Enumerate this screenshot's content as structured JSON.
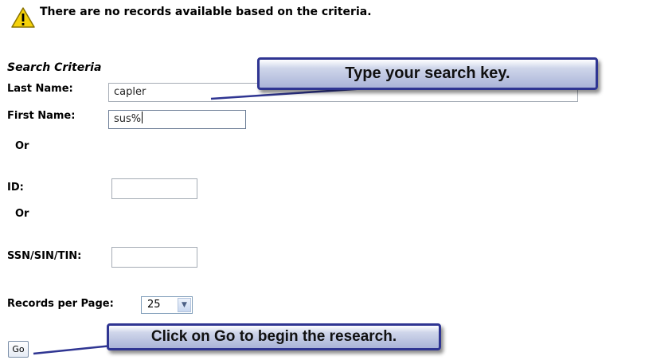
{
  "notice": {
    "icon": "warning-icon",
    "message": "There are no records available based on the criteria."
  },
  "search": {
    "title": "Search Criteria",
    "last_name": {
      "label": "Last Name:",
      "value": "capler"
    },
    "first_name": {
      "label": "First Name:",
      "value": "sus%"
    },
    "or_1": "Or",
    "id": {
      "label": "ID:",
      "value": ""
    },
    "or_2": "Or",
    "ssn": {
      "label": "SSN/SIN/TIN:",
      "value": ""
    },
    "records_per_page": {
      "label": "Records per Page:",
      "value": "25"
    },
    "go_label": "Go"
  },
  "callouts": {
    "search_key": "Type your search key.",
    "go_hint": "Click on Go to begin the research."
  },
  "colors": {
    "warning": "#f5d20a",
    "callout_border": "#2f3592"
  }
}
